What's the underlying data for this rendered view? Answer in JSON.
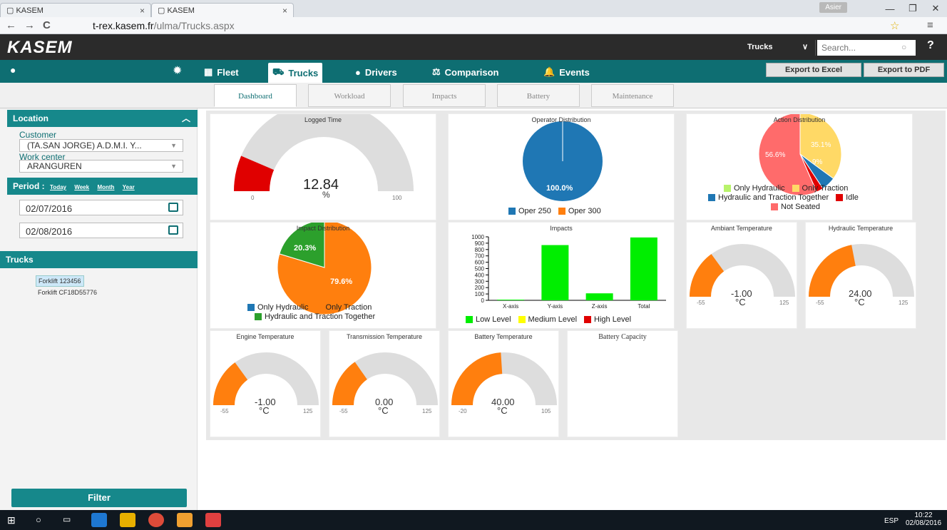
{
  "browser": {
    "tabs": [
      {
        "title": "KASEM"
      },
      {
        "title": "KASEM"
      }
    ],
    "user_badge": "Asier",
    "url_domain": "t-rex.kasem.fr",
    "url_path": "/ulma/Trucks.aspx"
  },
  "topbar": {
    "logo": "KASEM",
    "search_scope": "Trucks",
    "search_placeholder": "Search...",
    "help": "?"
  },
  "nav": {
    "items": [
      {
        "label": "Fleet"
      },
      {
        "label": "Trucks"
      },
      {
        "label": "Drivers"
      },
      {
        "label": "Comparison"
      },
      {
        "label": "Events"
      }
    ],
    "export_excel": "Export to Excel",
    "export_pdf": "Export to PDF"
  },
  "subtabs": [
    {
      "label": "Dashboard"
    },
    {
      "label": "Workload"
    },
    {
      "label": "Impacts"
    },
    {
      "label": "Battery"
    },
    {
      "label": "Maintenance"
    }
  ],
  "sidebar": {
    "location_title": "Location",
    "customer_label": "Customer",
    "customer_value": "(TA.SAN JORGE) A.D.M.I. Y...",
    "workcenter_label": "Work center",
    "workcenter_value": "ARANGUREN",
    "period_label": "Period :",
    "period_links": [
      "Today",
      "Week",
      "Month",
      "Year"
    ],
    "date_from": "02/07/2016",
    "date_to": "02/08/2016",
    "trucks_title": "Trucks",
    "trucks": [
      "Forklift 123456",
      "Forklift CF18D55776"
    ],
    "filter": "Filter"
  },
  "colors": {
    "teal": "#0e6e72",
    "teal_light": "#16888b",
    "orange": "#ff7f0e",
    "red": "#e00000",
    "gray": "#dddddd",
    "blue": "#1f77b4",
    "green": "#2ca02c",
    "lime": "#00ee00"
  },
  "panels": {
    "logged_time": {
      "title": "Logged Time",
      "value": "12.84",
      "unit": "%",
      "min": "0",
      "max": "100",
      "fraction": 0.1284
    },
    "operator": {
      "title": "Operator Distribution",
      "slice_label": "100.0%",
      "legend": [
        "Oper 250",
        "Oper 300"
      ],
      "values": [
        100,
        0
      ]
    },
    "action": {
      "title": "Action Distribution",
      "labels": [
        "56.6%",
        "35.1%",
        "9%"
      ],
      "legend": [
        "Only Hydraulic",
        "Only Traction",
        "Hydraulic and Traction Together",
        "Idle",
        "Not Seated"
      ],
      "values": [
        0,
        35.1,
        5.6,
        2.7,
        56.6
      ]
    },
    "impact_dist": {
      "title": "Impact Distribution",
      "labels": [
        "20.3%",
        "79.6%"
      ],
      "legend": [
        "Only Hydraulic",
        "Only Traction",
        "Hydraulic and Traction Together"
      ],
      "values": [
        0,
        79.6,
        20.3
      ]
    },
    "ambiant": {
      "title": "Ambiant Temperature",
      "value": "-1.00",
      "unit": "°C",
      "min": "-55",
      "max": "125",
      "fraction": 0.3
    },
    "hydraulic": {
      "title": "Hydraulic Temperature",
      "value": "24.00",
      "unit": "°C",
      "min": "-55",
      "max": "125",
      "fraction": 0.44
    },
    "engine": {
      "title": "Engine Temperature",
      "value": "-1.00",
      "unit": "°C",
      "min": "-55",
      "max": "125",
      "fraction": 0.3
    },
    "transmission": {
      "title": "Transmission Temperature",
      "value": "0.00",
      "unit": "°C",
      "min": "-55",
      "max": "125",
      "fraction": 0.306
    },
    "battery_temp": {
      "title": "Battery Temperature",
      "value": "40.00",
      "unit": "°C",
      "min": "-20",
      "max": "105",
      "fraction": 0.48
    },
    "battery_cap": {
      "title": "Battery Capacity"
    }
  },
  "chart_data": {
    "type": "bar",
    "title": "Impacts",
    "categories": [
      "X-axis",
      "Y-axis",
      "Z-axis",
      "Total"
    ],
    "series": [
      {
        "name": "Low Level",
        "values": [
          10,
          870,
          110,
          990
        ]
      },
      {
        "name": "Medium Level",
        "values": [
          0,
          0,
          0,
          0
        ]
      },
      {
        "name": "High Level",
        "values": [
          0,
          0,
          0,
          0
        ]
      }
    ],
    "yticks": [
      "1000",
      "900",
      "800",
      "700",
      "600",
      "500",
      "400",
      "300",
      "200",
      "100",
      "0"
    ],
    "ylim": [
      0,
      1000
    ]
  },
  "taskbar": {
    "time": "10:22",
    "date": "02/08/2016",
    "lang": "ESP"
  }
}
